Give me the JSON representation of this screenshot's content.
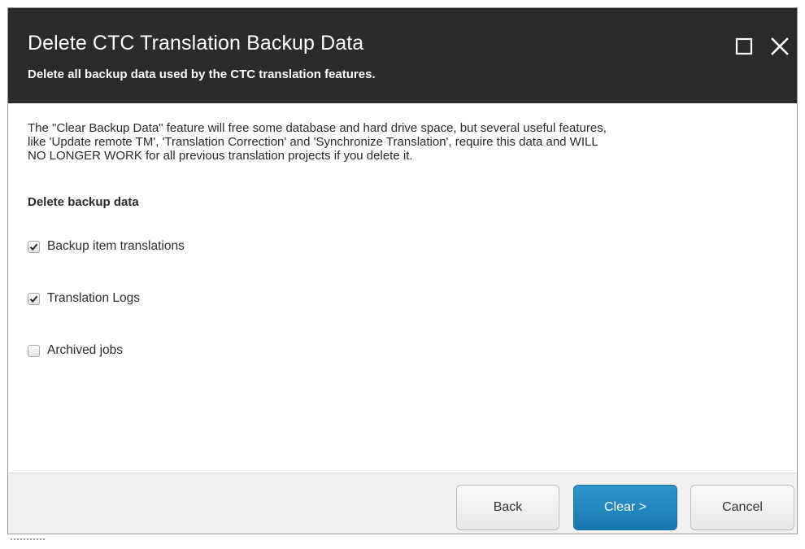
{
  "dialog": {
    "title": "Delete CTC Translation Backup Data",
    "subtitle": "Delete all backup data used by the CTC translation features.",
    "maximize_icon": "maximize-icon",
    "close_icon": "close-icon"
  },
  "body": {
    "intro_line1": "The \"Clear Backup Data\" feature will free some database and hard drive space, but several useful features,",
    "intro_line2": "like 'Update remote TM', 'Translation Correction' and 'Synchronize Translation', require this data and WILL",
    "intro_line3": "NO LONGER WORK for all previous translation projects if you delete it.",
    "section_title": "Delete backup data",
    "options": [
      {
        "label": "Backup item translations",
        "checked": true
      },
      {
        "label": "Translation Logs",
        "checked": true
      },
      {
        "label": "Archived jobs",
        "checked": false
      }
    ]
  },
  "footer": {
    "back_label": "Back",
    "clear_label": "Clear >",
    "cancel_label": "Cancel"
  },
  "colors": {
    "header_bg": "#2b2b2b",
    "primary_button": "#2586bf",
    "footer_bg": "#f1f1f1"
  }
}
